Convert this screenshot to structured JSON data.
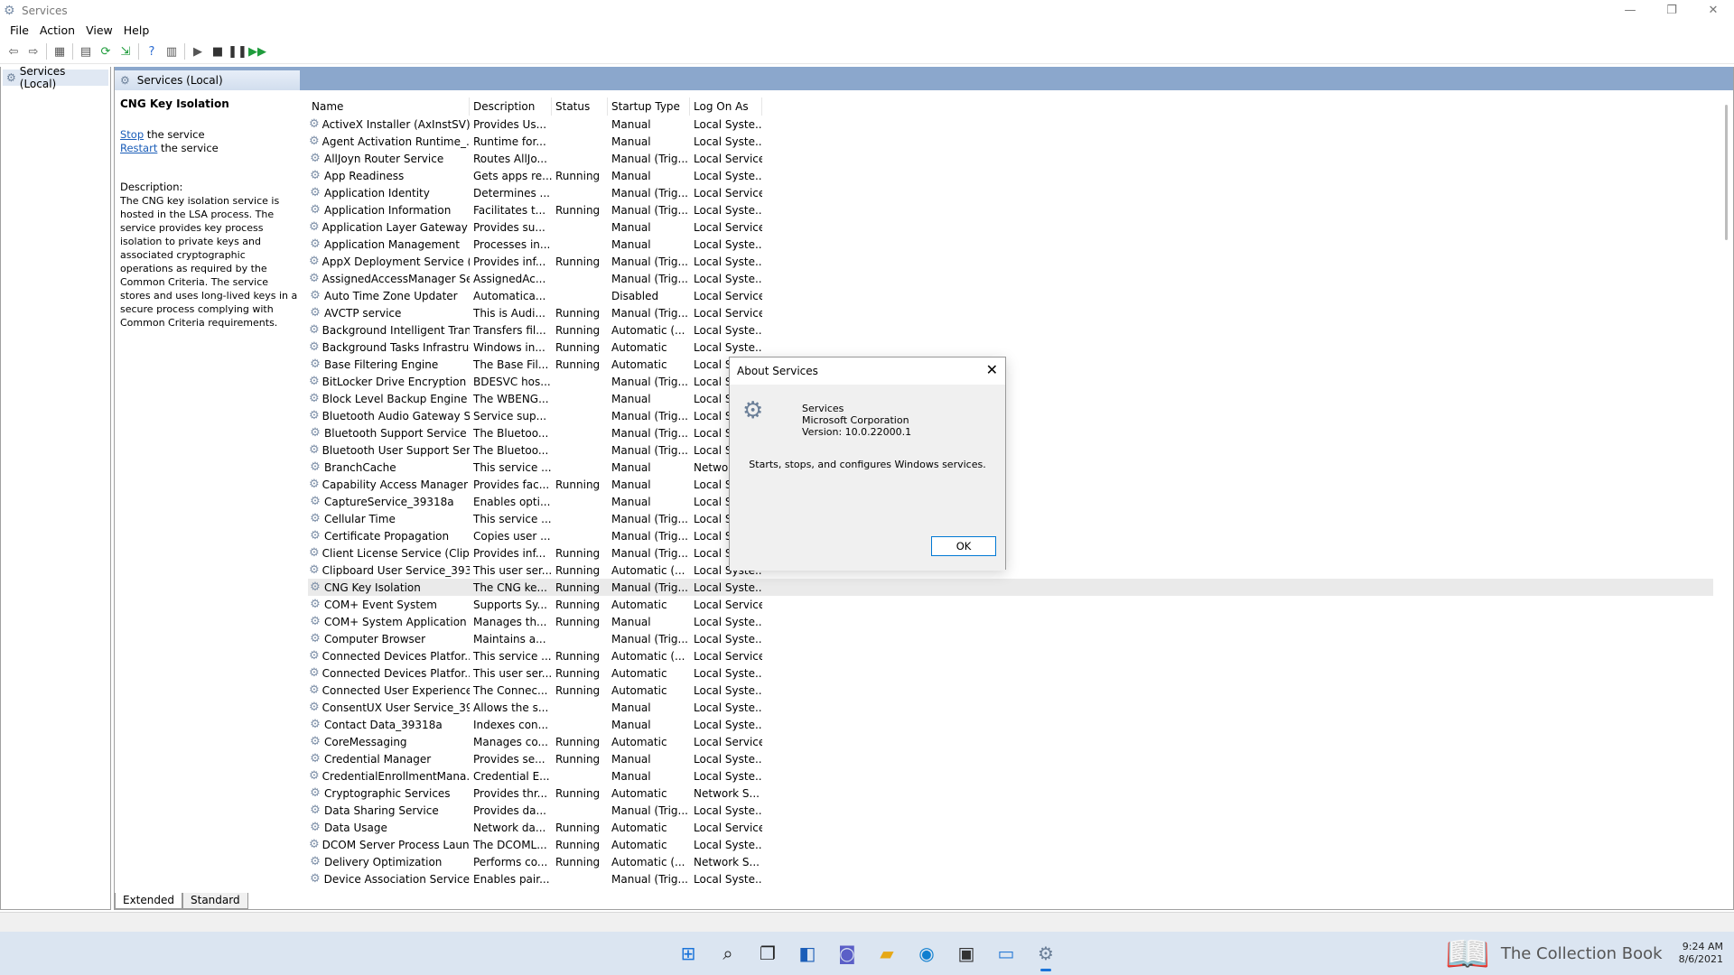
{
  "window": {
    "title": "Services",
    "controls": {
      "minimize": "—",
      "restore": "❐",
      "close": "✕"
    }
  },
  "menu": [
    "File",
    "Action",
    "View",
    "Help"
  ],
  "tree": {
    "item": "Services (Local)"
  },
  "header": {
    "tab": "Services (Local)"
  },
  "details": {
    "name": "CNG Key Isolation",
    "stop_link": "Stop",
    "stop_rest": " the service",
    "restart_link": "Restart",
    "restart_rest": " the service",
    "desc_label": "Description:",
    "desc_text": "The CNG key isolation service is hosted in the LSA process. The service provides key process isolation to private keys and associated cryptographic operations as required by the Common Criteria. The service stores and uses long-lived keys in a secure process complying with Common Criteria requirements."
  },
  "columns": {
    "name": "Name",
    "description": "Description",
    "status": "Status",
    "startup": "Startup Type",
    "logon": "Log On As"
  },
  "services": [
    [
      "ActiveX Installer (AxInstSV)",
      "Provides Us...",
      "",
      "Manual",
      "Local Syste..."
    ],
    [
      "Agent Activation Runtime_...",
      "Runtime for...",
      "",
      "Manual",
      "Local Syste..."
    ],
    [
      "AllJoyn Router Service",
      "Routes AllJo...",
      "",
      "Manual (Trig...",
      "Local Service"
    ],
    [
      "App Readiness",
      "Gets apps re...",
      "Running",
      "Manual",
      "Local Syste..."
    ],
    [
      "Application Identity",
      "Determines ...",
      "",
      "Manual (Trig...",
      "Local Service"
    ],
    [
      "Application Information",
      "Facilitates t...",
      "Running",
      "Manual (Trig...",
      "Local Syste..."
    ],
    [
      "Application Layer Gateway ...",
      "Provides su...",
      "",
      "Manual",
      "Local Service"
    ],
    [
      "Application Management",
      "Processes in...",
      "",
      "Manual",
      "Local Syste..."
    ],
    [
      "AppX Deployment Service (...",
      "Provides inf...",
      "Running",
      "Manual (Trig...",
      "Local Syste..."
    ],
    [
      "AssignedAccessManager Se...",
      "AssignedAc...",
      "",
      "Manual (Trig...",
      "Local Syste..."
    ],
    [
      "Auto Time Zone Updater",
      "Automatica...",
      "",
      "Disabled",
      "Local Service"
    ],
    [
      "AVCTP service",
      "This is Audi...",
      "Running",
      "Manual (Trig...",
      "Local Service"
    ],
    [
      "Background Intelligent Tran...",
      "Transfers fil...",
      "Running",
      "Automatic (...",
      "Local Syste..."
    ],
    [
      "Background Tasks Infrastruc...",
      "Windows in...",
      "Running",
      "Automatic",
      "Local Syste..."
    ],
    [
      "Base Filtering Engine",
      "The Base Fil...",
      "Running",
      "Automatic",
      "Local Se"
    ],
    [
      "BitLocker Drive Encryption ...",
      "BDESVC hos...",
      "",
      "Manual (Trig...",
      "Local Sy"
    ],
    [
      "Block Level Backup Engine ...",
      "The WBENG...",
      "",
      "Manual",
      "Local Sy"
    ],
    [
      "Bluetooth Audio Gateway S...",
      "Service sup...",
      "",
      "Manual (Trig...",
      "Local Se"
    ],
    [
      "Bluetooth Support Service",
      "The Bluetoo...",
      "",
      "Manual (Trig...",
      "Local Se"
    ],
    [
      "Bluetooth User Support Ser...",
      "The Bluetoo...",
      "",
      "Manual (Trig...",
      "Local Sy"
    ],
    [
      "BranchCache",
      "This service ...",
      "",
      "Manual",
      "Network"
    ],
    [
      "Capability Access Manager ...",
      "Provides fac...",
      "Running",
      "Manual",
      "Local Sy"
    ],
    [
      "CaptureService_39318a",
      "Enables opti...",
      "",
      "Manual",
      "Local Sy"
    ],
    [
      "Cellular Time",
      "This service ...",
      "",
      "Manual (Trig...",
      "Local Se"
    ],
    [
      "Certificate Propagation",
      "Copies user ...",
      "",
      "Manual (Trig...",
      "Local Sy"
    ],
    [
      "Client License Service (ClipS...",
      "Provides inf...",
      "Running",
      "Manual (Trig...",
      "Local Sy"
    ],
    [
      "Clipboard User Service_3931...",
      "This user ser...",
      "Running",
      "Automatic (...",
      "Local Syste..."
    ],
    [
      "CNG Key Isolation",
      "The CNG ke...",
      "Running",
      "Manual (Trig...",
      "Local Syste..."
    ],
    [
      "COM+ Event System",
      "Supports Sy...",
      "Running",
      "Automatic",
      "Local Service"
    ],
    [
      "COM+ System Application",
      "Manages th...",
      "Running",
      "Manual",
      "Local Syste..."
    ],
    [
      "Computer Browser",
      "Maintains a...",
      "",
      "Manual (Trig...",
      "Local Syste..."
    ],
    [
      "Connected Devices Platfor...",
      "This service ...",
      "Running",
      "Automatic (...",
      "Local Service"
    ],
    [
      "Connected Devices Platfor...",
      "This user ser...",
      "Running",
      "Automatic",
      "Local Syste..."
    ],
    [
      "Connected User Experience...",
      "The Connec...",
      "Running",
      "Automatic",
      "Local Syste..."
    ],
    [
      "ConsentUX User Service_39...",
      "Allows the s...",
      "",
      "Manual",
      "Local Syste..."
    ],
    [
      "Contact Data_39318a",
      "Indexes con...",
      "",
      "Manual",
      "Local Syste..."
    ],
    [
      "CoreMessaging",
      "Manages co...",
      "Running",
      "Automatic",
      "Local Service"
    ],
    [
      "Credential Manager",
      "Provides se...",
      "Running",
      "Manual",
      "Local Syste..."
    ],
    [
      "CredentialEnrollmentMana...",
      "Credential E...",
      "",
      "Manual",
      "Local Syste..."
    ],
    [
      "Cryptographic Services",
      "Provides thr...",
      "Running",
      "Automatic",
      "Network S..."
    ],
    [
      "Data Sharing Service",
      "Provides da...",
      "",
      "Manual (Trig...",
      "Local Syste..."
    ],
    [
      "Data Usage",
      "Network da...",
      "Running",
      "Automatic",
      "Local Service"
    ],
    [
      "DCOM Server Process Laun...",
      "The DCOML...",
      "Running",
      "Automatic",
      "Local Syste..."
    ],
    [
      "Delivery Optimization",
      "Performs co...",
      "Running",
      "Automatic (...",
      "Network S..."
    ],
    [
      "Device Association Service",
      "Enables pair...",
      "",
      "Manual (Trig...",
      "Local Syste..."
    ]
  ],
  "selected_index": 27,
  "tabs": {
    "extended": "Extended",
    "standard": "Standard"
  },
  "dialog": {
    "title": "About Services",
    "close": "✕",
    "product": "Services",
    "company": "Microsoft Corporation",
    "version": "Version: 10.0.22000.1",
    "message": "Starts, stops, and configures Windows services.",
    "ok": "OK"
  },
  "tray": {
    "watermark": "The Collection Book",
    "time": "9:24 AM",
    "date": "8/6/2021"
  }
}
